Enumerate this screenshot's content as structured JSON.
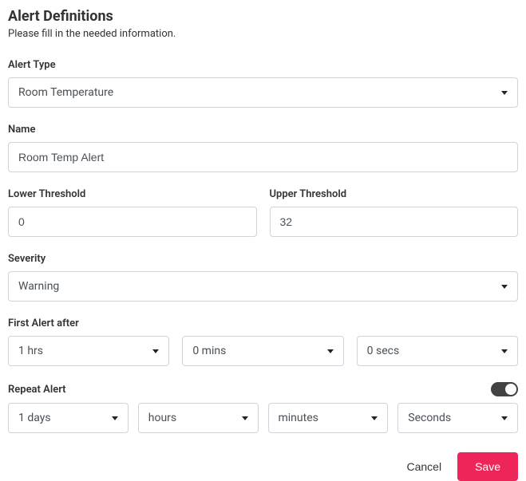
{
  "header": {
    "title": "Alert Definitions",
    "subtitle": "Please fill in the needed information."
  },
  "alert_type": {
    "label": "Alert Type",
    "value": "Room Temperature"
  },
  "name": {
    "label": "Name",
    "value": "Room Temp Alert"
  },
  "lower_threshold": {
    "label": "Lower Threshold",
    "value": "0"
  },
  "upper_threshold": {
    "label": "Upper Threshold",
    "value": "32"
  },
  "severity": {
    "label": "Severity",
    "value": "Warning"
  },
  "first_alert": {
    "label": "First Alert after",
    "hrs": "1 hrs",
    "mins": "0 mins",
    "secs": "0 secs"
  },
  "repeat_alert": {
    "label": "Repeat Alert",
    "enabled": true,
    "days": "1 days",
    "hours": "hours",
    "minutes": "minutes",
    "seconds": "Seconds"
  },
  "footer": {
    "cancel": "Cancel",
    "save": "Save"
  }
}
